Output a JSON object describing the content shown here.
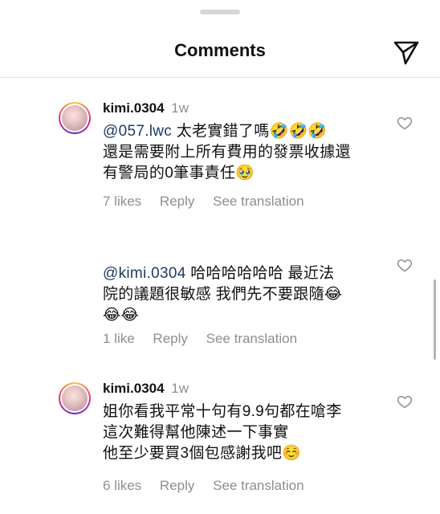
{
  "header": {
    "title": "Comments",
    "share_icon": "send-icon"
  },
  "comments": [
    {
      "username": "kimi.0304",
      "time": "1w",
      "mention": "@057.lwc",
      "lines": [
        "太老實錯了嗎🤣🤣🤣",
        "還是需要附上所有費用的發票收據還",
        "有警局的0筆事責任🥹"
      ],
      "likes": "7 likes",
      "reply": "Reply",
      "translation": "See translation"
    },
    {
      "mention": "@kimi.0304",
      "lines": [
        "哈哈哈哈哈哈  最近法",
        "院的議題很敏感 我們先不要跟隨😂",
        "😂😂"
      ],
      "likes": "1 like",
      "reply": "Reply",
      "translation": "See translation"
    },
    {
      "username": "kimi.0304",
      "time": "1w",
      "lines": [
        "姐你看我平常十句有9.9句都在嗆李",
        "這次難得幫他陳述一下事實",
        "他至少要買3個包感謝我吧☺️"
      ],
      "likes": "6 likes",
      "reply": "Reply",
      "translation": "See translation"
    }
  ]
}
